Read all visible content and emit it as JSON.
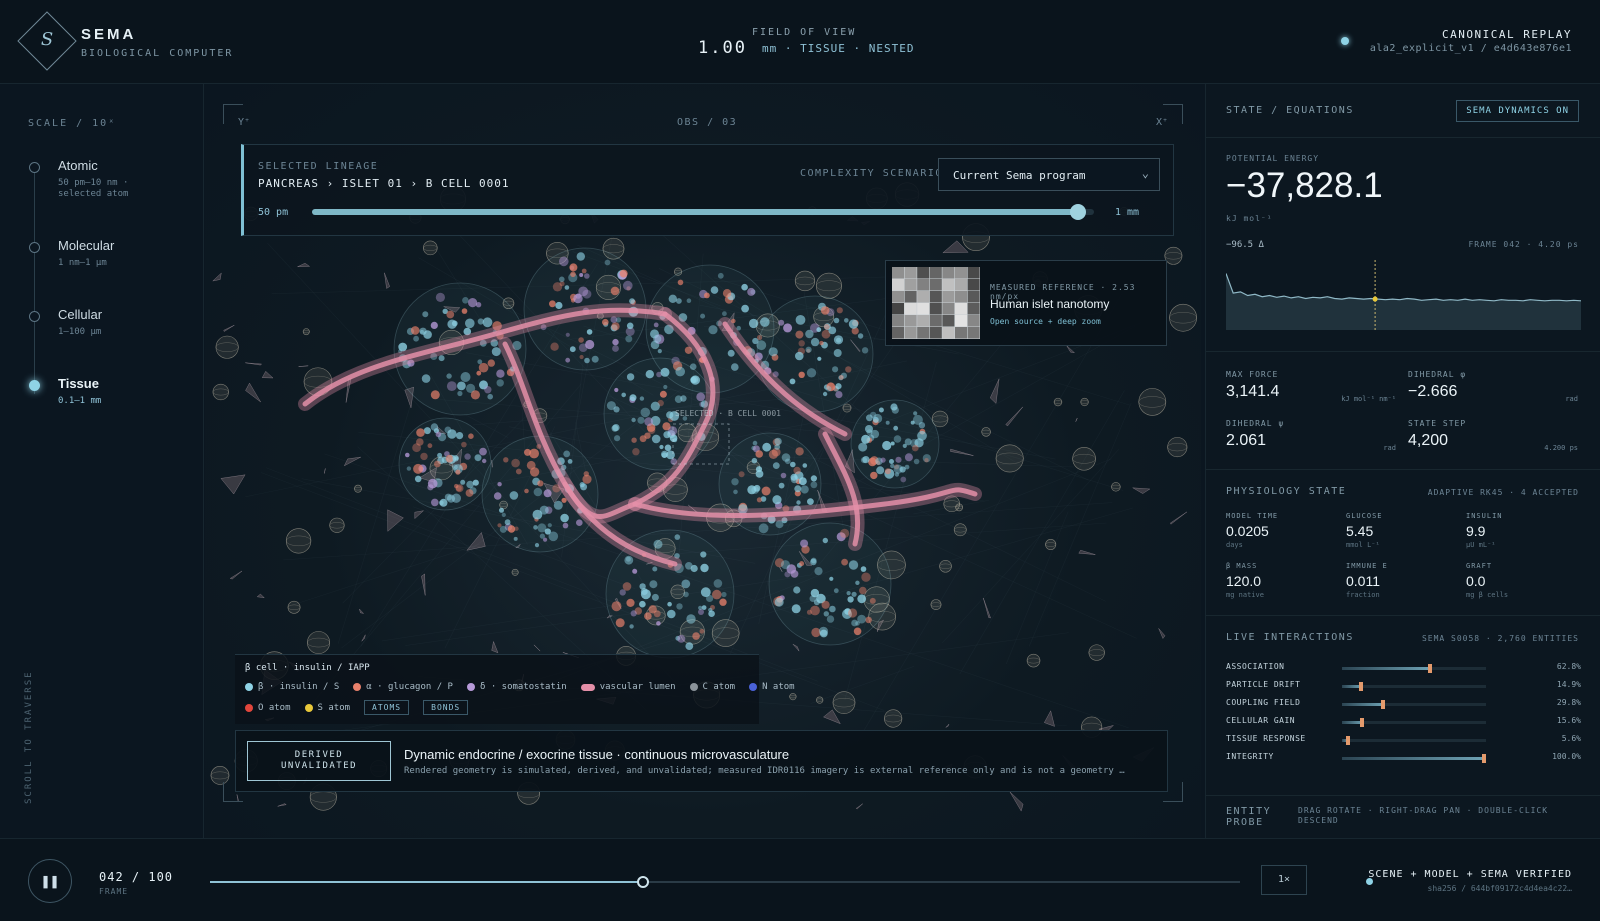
{
  "header": {
    "brand": "SEMA",
    "brand_sub": "BIOLOGICAL COMPUTER",
    "logo_glyph": "S",
    "fov_label": "FIELD OF VIEW",
    "fov_value": "1.00",
    "fov_detail": "mm · TISSUE · NESTED",
    "replay_title": "CANONICAL REPLAY",
    "replay_sub": "ala2_explicit_v1 / e4d643e876e1"
  },
  "scale": {
    "label": "SCALE / 10ˣ",
    "items": [
      {
        "name": "Atomic",
        "range": "50 pm–10 nm · selected atom"
      },
      {
        "name": "Molecular",
        "range": "1 nm–1 µm"
      },
      {
        "name": "Cellular",
        "range": "1–100 µm"
      },
      {
        "name": "Tissue",
        "range": "0.1–1 mm"
      }
    ],
    "active_index": 3,
    "scroll_hint": "SCROLL TO TRAVERSE"
  },
  "viewport": {
    "axis_y": "Y⁺",
    "axis_x": "X⁺",
    "obs_label": "OBS / 03",
    "lineage_label": "SELECTED LINEAGE",
    "lineage_path": "PANCREAS › ISLET 01 › B CELL 0001",
    "complexity_label": "COMPLEXITY SCENARIO",
    "complexity_value": "Current Sema program",
    "range_min": "50 pm",
    "range_max": "1 mm",
    "range_fraction": 0.98,
    "reference": {
      "tag": "MEASURED REFERENCE · 2.53 nm/px",
      "title": "Human islet nanotomy",
      "link": "Open source + deep zoom"
    },
    "selected_marker": "SELECTED · B CELL 0001",
    "legend": {
      "title": "β cell · insulin / IAPP",
      "items": [
        {
          "label": "β · insulin / S",
          "color": "#8fd3e6",
          "shape": "dot"
        },
        {
          "label": "α · glucagon / P",
          "color": "#e8806b",
          "shape": "dot"
        },
        {
          "label": "δ · somatostatin",
          "color": "#b79ad8",
          "shape": "dot"
        },
        {
          "label": "vascular lumen",
          "color": "#e48fa8",
          "shape": "bar"
        },
        {
          "label": "C atom",
          "color": "#8a9299",
          "shape": "dot"
        },
        {
          "label": "N atom",
          "color": "#4a62d8",
          "shape": "dot"
        }
      ],
      "items2": [
        {
          "label": "O atom",
          "color": "#e2463c",
          "shape": "dot"
        },
        {
          "label": "S atom",
          "color": "#e8c83a",
          "shape": "dot"
        }
      ],
      "toggle_atoms": "ATOMS",
      "toggle_bonds": "BONDS"
    },
    "status": {
      "badge_line1": "DERIVED",
      "badge_line2": "UNVALIDATED",
      "title": "Dynamic endocrine / exocrine tissue · continuous microvasculature",
      "desc": "Rendered geometry is simulated, derived, and unvalidated; measured IDR0116 imagery is external reference only and is not a geometry …"
    }
  },
  "state": {
    "label": "STATE / EQUATIONS",
    "dynamics_btn": "SEMA DYNAMICS ON",
    "pe_label": "POTENTIAL ENERGY",
    "pe_value": "−37,828.1",
    "pe_unit": "kJ mol⁻¹",
    "pe_delta": "−96.5 Δ",
    "pe_frame": "FRAME 042 · 4.20 ps",
    "energy_series": [
      0.95,
      0.62,
      0.64,
      0.58,
      0.6,
      0.56,
      0.58,
      0.55,
      0.57,
      0.54,
      0.56,
      0.53,
      0.55,
      0.54,
      0.56,
      0.53,
      0.52,
      0.54,
      0.53,
      0.52,
      0.53,
      0.52,
      0.51,
      0.52,
      0.51,
      0.53,
      0.52,
      0.5,
      0.51,
      0.52,
      0.5,
      0.51,
      0.5,
      0.52,
      0.5,
      0.51,
      0.5,
      0.49,
      0.51,
      0.5,
      0.5,
      0.49,
      0.51,
      0.5,
      0.49,
      0.5,
      0.5,
      0.49,
      0.5,
      0.49
    ],
    "energy_cursor_fraction": 0.42,
    "max_force_label": "MAX FORCE",
    "max_force": "3,141.4",
    "max_force_unit": "kJ mol⁻¹ nm⁻¹",
    "dihedral_phi_label": "DIHEDRAL φ",
    "dihedral_phi": "−2.666",
    "dihedral_phi_unit": "rad",
    "dihedral_psi_label": "DIHEDRAL ψ",
    "dihedral_psi": "2.061",
    "dihedral_psi_unit": "rad",
    "state_step_label": "STATE STEP",
    "state_step": "4,200",
    "state_step_unit": "4.200 ps"
  },
  "physiology": {
    "label": "PHYSIOLOGY STATE",
    "meta": "ADAPTIVE RK45 · 4 ACCEPTED",
    "cells": [
      {
        "label": "MODEL TIME",
        "value": "0.0205",
        "unit": "days"
      },
      {
        "label": "GLUCOSE",
        "value": "5.45",
        "unit": "mmol L⁻¹"
      },
      {
        "label": "INSULIN",
        "value": "9.9",
        "unit": "µU mL⁻¹"
      },
      {
        "label": "β MASS",
        "value": "120.0",
        "unit": "mg native"
      },
      {
        "label": "IMMUNE E",
        "value": "0.011",
        "unit": "fraction"
      },
      {
        "label": "GRAFT",
        "value": "0.0",
        "unit": "mg β cells"
      }
    ]
  },
  "interactions": {
    "label": "LIVE INTERACTIONS",
    "meta": "SEMA S0058 · 2,760 ENTITIES",
    "rows": [
      {
        "name": "ASSOCIATION",
        "value": "62.8%",
        "fraction": 0.628
      },
      {
        "name": "PARTICLE DRIFT",
        "value": "14.9%",
        "fraction": 0.149
      },
      {
        "name": "COUPLING FIELD",
        "value": "29.8%",
        "fraction": 0.298
      },
      {
        "name": "CELLULAR GAIN",
        "value": "15.6%",
        "fraction": 0.156
      },
      {
        "name": "TISSUE RESPONSE",
        "value": "5.6%",
        "fraction": 0.056
      },
      {
        "name": "INTEGRITY",
        "value": "100.0%",
        "fraction": 1.0
      }
    ]
  },
  "probe": {
    "label": "ENTITY PROBE",
    "hint": "DRAG ROTATE · RIGHT-DRAG PAN · DOUBLE-CLICK DESCEND"
  },
  "playback": {
    "pause_glyph": "❚❚",
    "frame": "042 / 100",
    "frame_label": "FRAME",
    "progress_fraction": 0.42,
    "speed": "1×",
    "verify_title": "SCENE + MODEL + SEMA VERIFIED",
    "verify_sub": "sha256 / 644bf09172c4d4ea4c22…"
  },
  "colors": {
    "accent": "#8fd3e6",
    "vessel": "#e48fa8",
    "knob": "#e39a6c"
  }
}
